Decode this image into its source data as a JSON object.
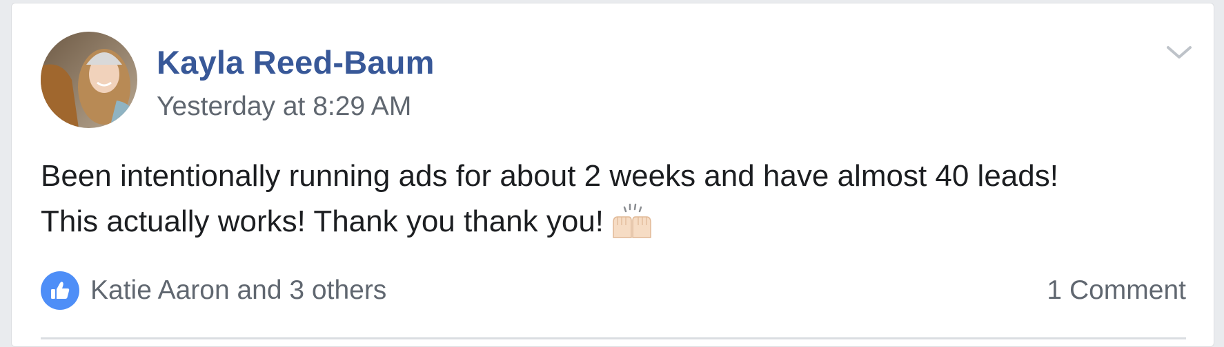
{
  "post": {
    "author": "Kayla Reed-Baum",
    "timestamp": "Yesterday at 8:29 AM",
    "body_lines": [
      "Been intentionally running ads for about 2 weeks and have almost 40 leads!",
      "This actually works! Thank you thank you!"
    ],
    "emoji": "raising-hands-emoji",
    "menu_icon": "chevron-down-icon",
    "reaction_icon": "like-thumb-icon",
    "reaction_summary": "Katie Aaron and 3 others",
    "comment_count": "1 Comment"
  },
  "colors": {
    "author_link": "#385898",
    "meta_text": "#606770",
    "body_text": "#1c1e21",
    "like_blue": "#4e8ef7"
  }
}
